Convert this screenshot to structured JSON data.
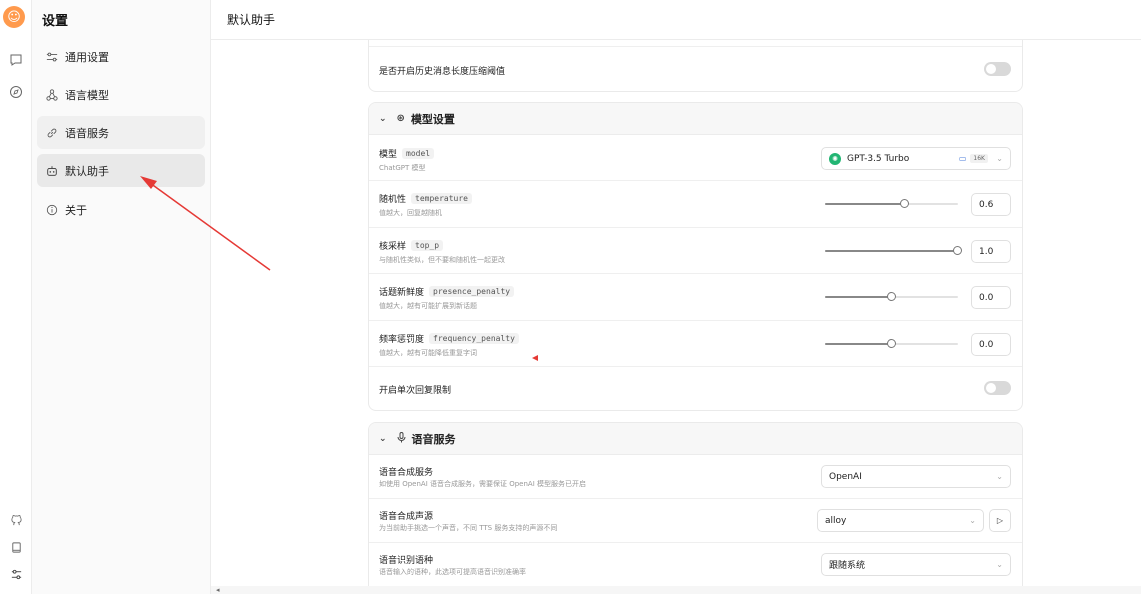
{
  "rail": {
    "icons": [
      "avatar-icon",
      "chat-icon",
      "compass-icon",
      "github-icon",
      "docs-icon",
      "settings-icon"
    ],
    "avatar_glyph": "☺",
    "chat_glyph": "▢",
    "compass_glyph": "◎",
    "github_glyph": "♁",
    "docs_glyph": "▭",
    "settings_glyph": "⚙"
  },
  "sidebar": {
    "title": "设置",
    "items": [
      {
        "label": "通用设置",
        "icon": "sliders-icon",
        "glyph": "⚌"
      },
      {
        "label": "语言模型",
        "icon": "model-icon",
        "glyph": "⚘"
      },
      {
        "label": "语音服务",
        "icon": "link-icon",
        "glyph": "⚲"
      },
      {
        "label": "默认助手",
        "icon": "bot-icon",
        "glyph": "▣"
      },
      {
        "label": "关于",
        "icon": "info-icon",
        "glyph": "ⓘ"
      }
    ]
  },
  "header": {
    "title": "默认助手"
  },
  "history_card": {
    "row_label": "是否开启历史消息长度压缩阈值",
    "toggle_on": false
  },
  "model_card": {
    "title": "模型设置",
    "rows": {
      "model": {
        "label": "模型",
        "code": "model",
        "desc": "ChatGPT 模型",
        "value": "GPT-3.5 Turbo",
        "ctx_tag": "16K"
      },
      "temperature": {
        "label": "随机性",
        "code": "temperature",
        "desc": "值越大，回复越随机",
        "value": "0.6",
        "fraction": 0.6
      },
      "top_p": {
        "label": "核采样",
        "code": "top_p",
        "desc": "与随机性类似，但不要和随机性一起更改",
        "value": "1.0",
        "fraction": 1.0
      },
      "presence_penalty": {
        "label": "话题新鲜度",
        "code": "presence_penalty",
        "desc": "值越大，越有可能扩展到新话题",
        "value": "0.0",
        "fraction": 0.5
      },
      "frequency_penalty": {
        "label": "频率惩罚度",
        "code": "frequency_penalty",
        "desc": "值越大，越有可能降低重复字词",
        "value": "0.0",
        "fraction": 0.5
      }
    },
    "single_reply_limit": {
      "label": "开启单次回复限制",
      "toggle_on": false
    }
  },
  "voice_card": {
    "title": "语音服务",
    "tts_service": {
      "label": "语音合成服务",
      "desc": "如使用 OpenAI 语音合成服务，需要保证 OpenAI 模型服务已开启",
      "value": "OpenAI"
    },
    "tts_voice": {
      "label": "语音合成声源",
      "desc": "为当前助手挑选一个声音，不同 TTS 服务支持的声源不同",
      "value": "alloy"
    },
    "stt_locale": {
      "label": "语音识别语种",
      "desc": "语音输入的语种，此选项可提高语音识别准确率",
      "value": "跟随系统"
    }
  },
  "colors": {
    "accent_arrow": "#e53935",
    "model_icon": "#22b573"
  }
}
